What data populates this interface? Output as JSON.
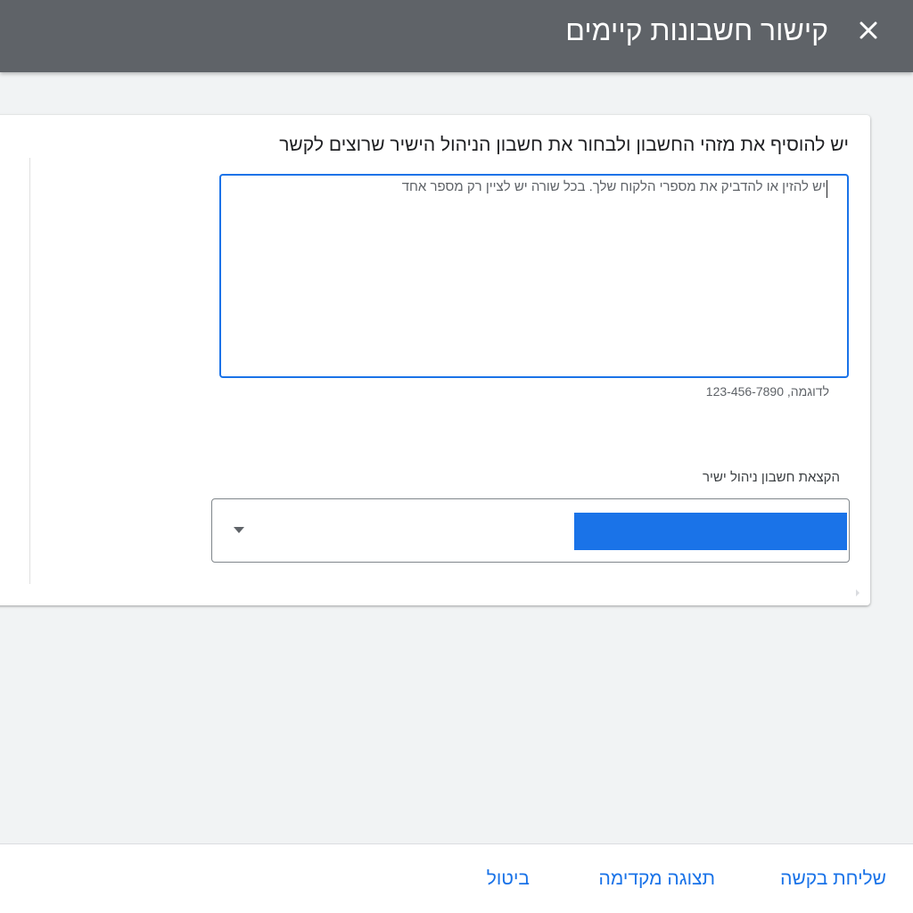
{
  "header": {
    "title": "קישור חשבונות קיימים",
    "close_icon": "close-icon"
  },
  "form": {
    "heading": "יש להוסיף את מזהי החשבון ולבחור את חשבון הניהול הישיר שרוצים לקשר",
    "textarea_placeholder": "יש להזין או להדביק את מספרי הלקוח שלך. בכל שורה יש לציין רק מספר אחד",
    "textarea_value": "",
    "hint": "לדוגמה, 123-456-7890",
    "dropdown_label": "הקצאת חשבון ניהול ישיר",
    "dropdown_selected": "",
    "dropdown_icon": "triangle-down-icon"
  },
  "footer": {
    "send_label": "שליחת בקשה",
    "preview_label": "תצוגה מקדימה",
    "cancel_label": "ביטול"
  },
  "colors": {
    "header_bg": "#5f6368",
    "accent": "#1a73e8",
    "page_bg": "#f1f3f4"
  }
}
